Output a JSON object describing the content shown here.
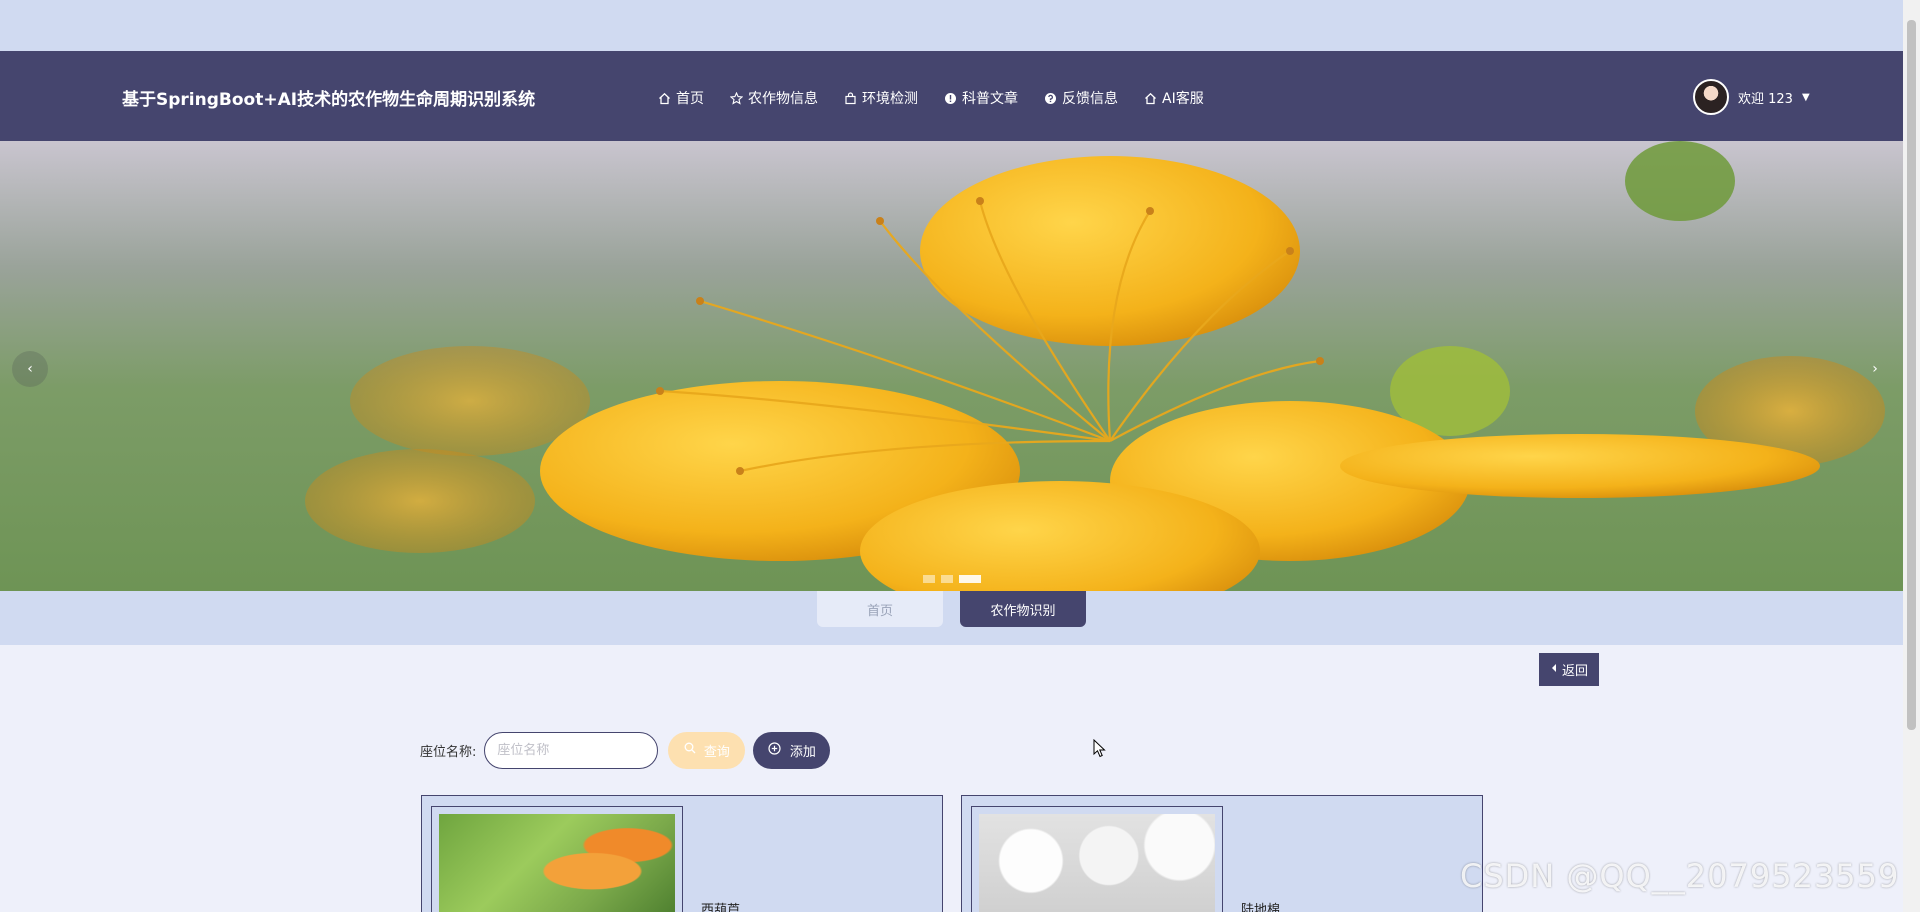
{
  "header": {
    "title": "基于SpringBoot+AI技术的农作物生命周期识别系统",
    "nav": [
      {
        "label": "首页",
        "icon": "home-icon"
      },
      {
        "label": "农作物信息",
        "icon": "star-icon"
      },
      {
        "label": "环境检测",
        "icon": "bag-icon"
      },
      {
        "label": "科普文章",
        "icon": "info-icon"
      },
      {
        "label": "反馈信息",
        "icon": "help-icon"
      },
      {
        "label": "AI客服",
        "icon": "home-icon"
      }
    ],
    "user": {
      "welcome": "欢迎 123"
    }
  },
  "carousel": {
    "slide_count": 3,
    "active_index": 2,
    "prev_symbol": "‹",
    "next_symbol": "›"
  },
  "tabs": {
    "home": "首页",
    "crop_recognition": "农作物识别"
  },
  "back_button": {
    "label": "返回"
  },
  "search": {
    "label": "座位名称:",
    "placeholder": "座位名称",
    "query_label": "查询",
    "add_label": "添加"
  },
  "cards": [
    {
      "name": "西葫芦"
    },
    {
      "name": "陆地棉"
    }
  ],
  "watermark": "CSDN @QQ__2079523559",
  "colors": {
    "primary": "#45456e",
    "band": "#d0daf1",
    "page_bg": "#eef0fa",
    "query_button": "#fde0b0"
  }
}
